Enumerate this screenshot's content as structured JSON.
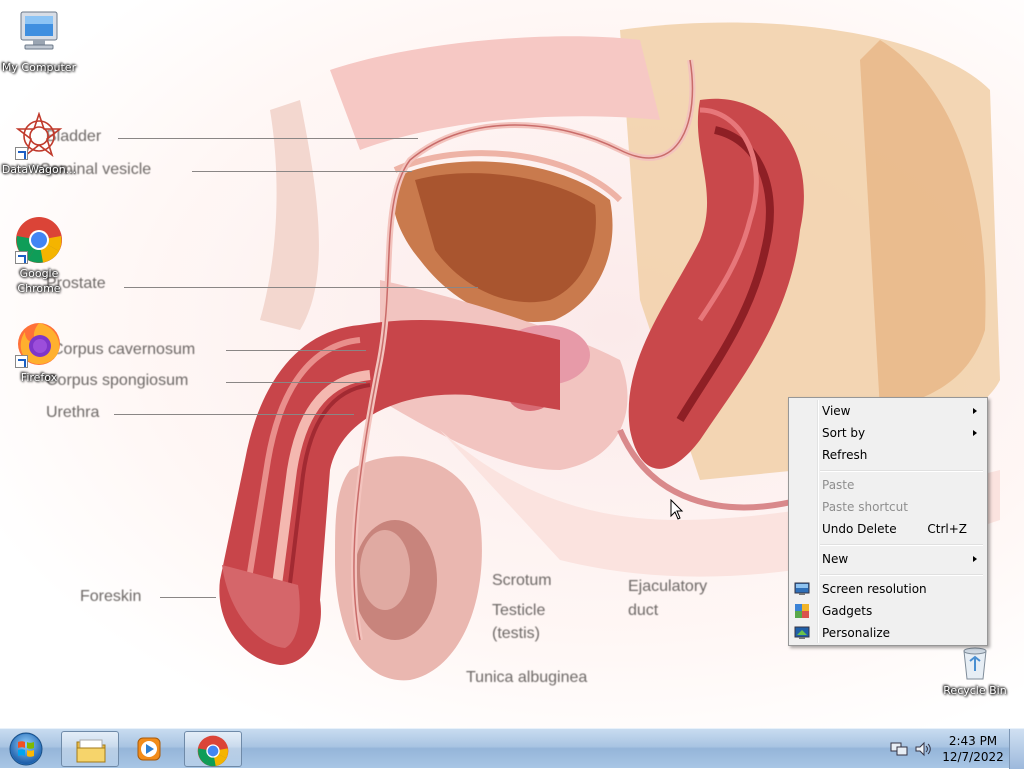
{
  "wallpaper": {
    "labels": {
      "bladder": "Bladder",
      "seminal_vesicle": "Seminal vesicle",
      "prostate": "Prostate",
      "corpus_cavernosum": "Corpus cavernosum",
      "corpus_spongiosum": "Corpus spongiosum",
      "urethra": "Urethra",
      "foreskin": "Foreskin",
      "scrotum": "Scrotum",
      "testicle": "Testicle",
      "testis": "(testis)",
      "tunica": "Tunica albuginea",
      "ejaculatory": "Ejaculatory",
      "duct": "duct"
    }
  },
  "desktop": {
    "icons": [
      {
        "label": "My Computer",
        "icon": "computer-icon"
      },
      {
        "label": "DataWagon...",
        "icon": "datawagon-icon"
      },
      {
        "label": "Google Chrome",
        "icon": "chrome-icon"
      },
      {
        "label": "Firefox",
        "icon": "firefox-icon"
      },
      {
        "label": "Recycle Bin",
        "icon": "recycle-bin-icon"
      }
    ]
  },
  "context_menu": {
    "items": [
      {
        "label": "View",
        "has_submenu": true,
        "enabled": true
      },
      {
        "label": "Sort by",
        "has_submenu": true,
        "enabled": true
      },
      {
        "label": "Refresh",
        "enabled": true
      },
      {
        "label": "Paste",
        "enabled": false
      },
      {
        "label": "Paste shortcut",
        "enabled": false
      },
      {
        "label": "Undo Delete",
        "shortcut": "Ctrl+Z",
        "enabled": true
      },
      {
        "label": "New",
        "has_submenu": true,
        "enabled": true
      },
      {
        "label": "Screen resolution",
        "icon": "screen-resolution-icon",
        "enabled": true
      },
      {
        "label": "Gadgets",
        "icon": "gadgets-icon",
        "enabled": true
      },
      {
        "label": "Personalize",
        "icon": "personalize-icon",
        "enabled": true
      }
    ]
  },
  "taskbar": {
    "pinned": [
      {
        "name": "Windows Explorer",
        "icon": "folder-icon"
      },
      {
        "name": "Windows Media Player",
        "icon": "media-player-icon"
      },
      {
        "name": "Google Chrome",
        "icon": "chrome-icon"
      }
    ],
    "clock": {
      "time": "2:43 PM",
      "date": "12/7/2022"
    }
  },
  "colors": {
    "taskbar": "#a9c4e2",
    "menu_bg": "#f0f0f0",
    "chrome_red": "#db4437",
    "chrome_green": "#0f9d58",
    "chrome_yellow": "#f4b400",
    "chrome_blue": "#4285f4"
  }
}
